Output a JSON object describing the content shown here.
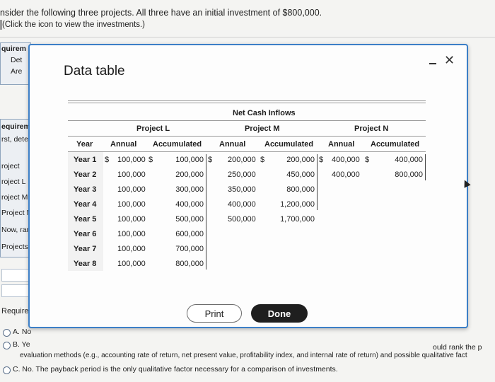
{
  "background": {
    "question": "nsider the following three projects. All three have an initial investment of $800,000.",
    "click_hint": "(Click the icon to view the investments.)",
    "left_labels_top": [
      "quirem",
      "Det",
      "Are"
    ],
    "left_labels_mid": [
      "equirem",
      "rst, dete",
      "roject",
      "roject L",
      "roject M",
      "Project N",
      "Now, rank",
      "Projects"
    ],
    "require_label": "Requirem",
    "answers": {
      "a": "A.  No",
      "b": "B.  Ye",
      "b_right": "ould rank the p",
      "b_line2": "evaluation methods (e.g., accounting rate of return, net present value, profitability index, and internal rate of return) and possible qualitative fact",
      "c": "C.  No. The payback period is the only qualitative factor necessary for a comparison of investments."
    }
  },
  "modal": {
    "title": "Data table",
    "print_label": "Print",
    "done_label": "Done"
  },
  "table": {
    "group_header": "Net Cash Inflows",
    "projects": [
      "Project L",
      "Project M",
      "Project N"
    ],
    "columns": [
      "Year",
      "Annual",
      "Accumulated",
      "Annual",
      "Accumulated",
      "Annual",
      "Accumulated"
    ],
    "years": [
      "Year 1",
      "Year 2",
      "Year 3",
      "Year 4",
      "Year 5",
      "Year 6",
      "Year 7",
      "Year 8"
    ],
    "currency": "$",
    "project_l": {
      "annual": [
        "100,000",
        "100,000",
        "100,000",
        "100,000",
        "100,000",
        "100,000",
        "100,000",
        "100,000"
      ],
      "accumulated": [
        "100,000",
        "200,000",
        "300,000",
        "400,000",
        "500,000",
        "600,000",
        "700,000",
        "800,000"
      ]
    },
    "project_m": {
      "annual": [
        "200,000",
        "250,000",
        "350,000",
        "400,000",
        "500,000"
      ],
      "accumulated": [
        "200,000",
        "450,000",
        "800,000",
        "1,200,000",
        "1,700,000"
      ]
    },
    "project_n": {
      "annual": [
        "400,000",
        "400,000"
      ],
      "accumulated": [
        "400,000",
        "800,000"
      ]
    }
  }
}
